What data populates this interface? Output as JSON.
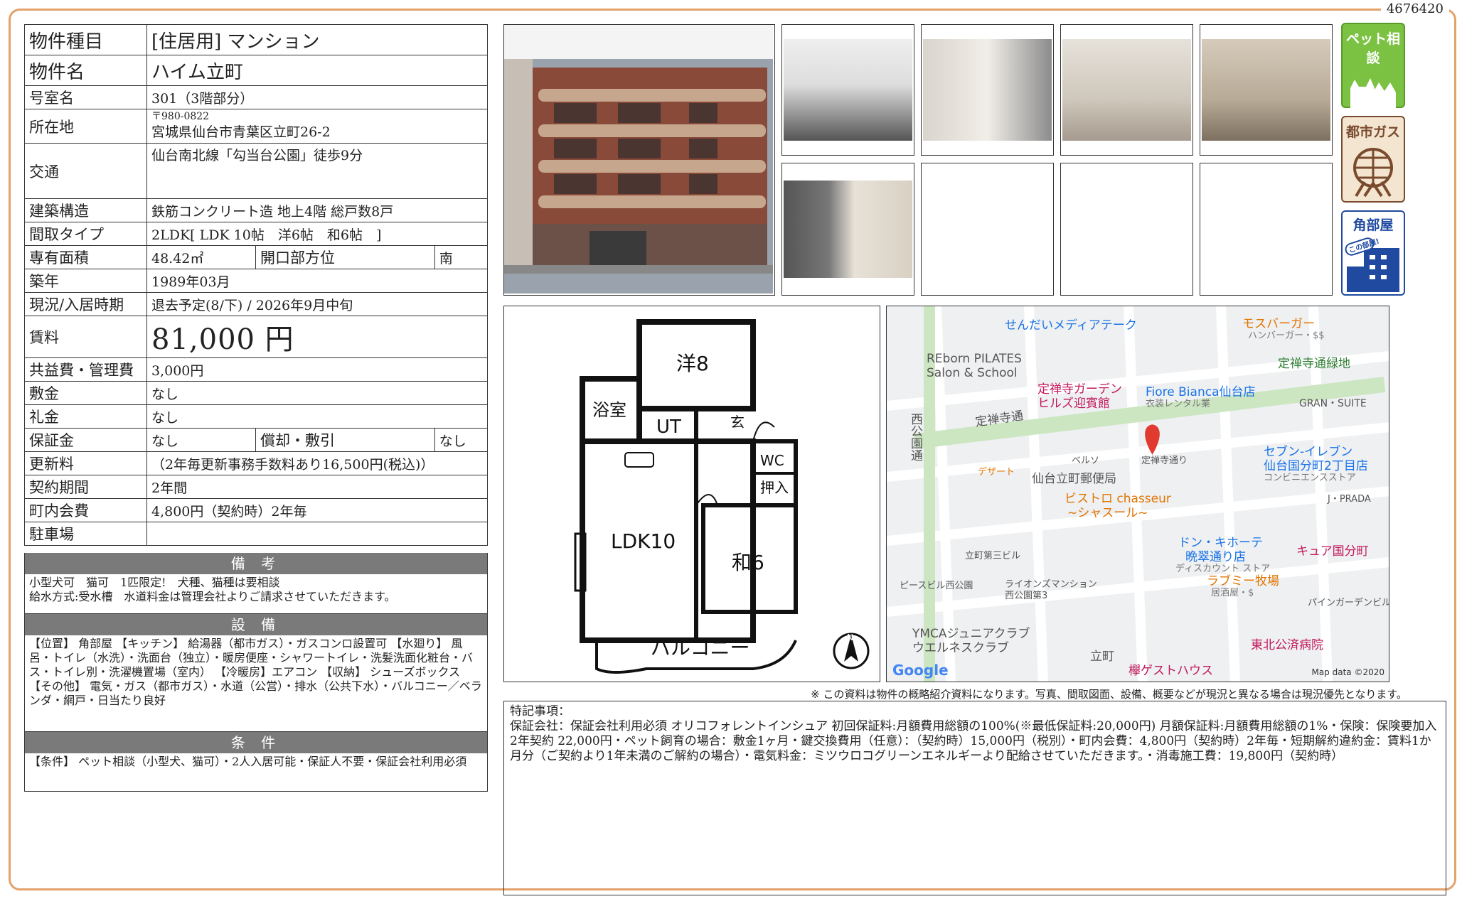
{
  "doc_id": "4676420",
  "property": {
    "type_label": "物件種目",
    "type_value": "[住居用] マンション",
    "name_label": "物件名",
    "name_value": "ハイム立町",
    "room_label": "号室名",
    "room_value": "301（3階部分）",
    "addr_label": "所在地",
    "zip": "〒980-0822",
    "addr_value": "宮城県仙台市青葉区立町26-2",
    "access_label": "交通",
    "access_value": "仙台南北線「勾当台公園」徒歩9分",
    "structure_label": "建築構造",
    "structure_value": "鉄筋コンクリート造 地上4階 総戸数8戸",
    "layout_label": "間取タイプ",
    "layout_value": "2LDK[ LDK 10帖　洋6帖　和6帖　]",
    "area_label": "専有面積",
    "area_value": "48.42㎡",
    "direction_label": "開口部方位",
    "direction_value": "南",
    "built_label": "築年",
    "built_value": "1989年03月",
    "status_label": "現況/入居時期",
    "status_value": "退去予定(8/下) / 2026年9月中旬",
    "rent_label": "賃料",
    "rent_value": "81,000 円",
    "fee_label": "共益費・管理費",
    "fee_value": "3,000円",
    "deposit_label": "敷金",
    "deposit_value": "なし",
    "keymoney_label": "礼金",
    "keymoney_value": "なし",
    "guarantee_label": "保証金",
    "guarantee_value": "なし",
    "amort_label": "償却・敷引",
    "amort_value": "なし",
    "renewal_label": "更新料",
    "renewal_value": "（2年毎更新事務手数料あり16,500円(税込)）",
    "contract_label": "契約期間",
    "contract_value": "2年間",
    "town_label": "町内会費",
    "town_value": "4,800円（契約時）2年毎",
    "parking_label": "駐車場",
    "parking_value": ""
  },
  "remarks": {
    "title": "備 考",
    "text": "小型犬可　猫可　1匹限定!　犬種、猫種は要相談\n給水方式:受水槽　水道料金は管理会社よりご請求させていただきます。"
  },
  "facilities": {
    "title": "設 備",
    "text": "【位置】 角部屋 【キッチン】 給湯器（都市ガス）・ガスコンロ設置可 【水廻り】 風呂・トイレ（水洗）・洗面台（独立）・暖房便座・シャワートイレ・洗髪洗面化粧台・バス・トイレ別・洗濯機置場（室内） 【冷暖房】エアコン 【収納】 シューズボックス 【その他】 電気・ガス（都市ガス）・水道（公営）・排水（公共下水）・バルコニー／ベランダ・網戸・日当たり良好"
  },
  "conditions": {
    "title": "条 件",
    "text": "【条件】 ペット相談（小型犬、猫可）・2人入居可能・保証人不要・保証会社利用必須"
  },
  "badges": {
    "pet": "ペット相談",
    "gas": "都市ガス",
    "corner": "角部屋",
    "corner_sub": "この部屋!"
  },
  "floorplan": {
    "rooms": {
      "western": "洋8",
      "bath": "浴室",
      "ut": "UT",
      "entrance": "玄",
      "wc": "WC",
      "closet": "押入",
      "ldk": "LDK10",
      "japanese": "和6",
      "balcony": "バルコニー"
    },
    "north": "N"
  },
  "map": {
    "labels": [
      "せんだいメディアテーク",
      "モスバーガー",
      "ハンバーガー・$$",
      "REborn PILATES",
      "Salon & School",
      "定禅寺通緑地",
      "定禅寺ガーデン",
      "ヒルズ迎賓館",
      "Fiore Bianca仙台店",
      "衣装レンタル業",
      "GRAN・SUITE",
      "定禅寺通",
      "西公園通",
      "デザート",
      "ベルソ",
      "定禅寺通り",
      "仙台立町郵便局",
      "セブン-イレブン",
      "仙台国分町2丁目店",
      "コンビニエンスストア",
      "ビストロ chasseur",
      "~シャスール~",
      "J・PRADA",
      "立町第三ビル",
      "ドン・キホーテ",
      "晩翠通り店",
      "ディスカウント ストア",
      "キュア国分町",
      "ピースビル西公園",
      "ライオンズマンション",
      "西公園第3",
      "ラブミー牧場",
      "居酒屋・$",
      "パインガーデンビル",
      "YMCAジュニアクラブ",
      "ウエルネスクラブ",
      "立町",
      "東北公済病院",
      "欅ゲストハウス"
    ],
    "google": "Google",
    "credit": "Map data ©2020"
  },
  "notice": "※ この資料は物件の概略紹介資料になります。写真、間取図面、設備、概要などが現況と異なる場合は現況優先となります。",
  "special": {
    "title": "特記事項：",
    "text": "保証会社：保証会社利用必須 オリコフォレントインシュア 初回保証料:月額費用総額の100%(※最低保証料:20,000円) 月額保証料:月額費用総額の1%・保険：保険要加入 2年契約 22,000円・ペット飼育の場合：敷金1ヶ月・鍵交換費用（任意）：（契約時）15,000円（税別）・町内会費：4,800円（契約時）2年毎・短期解約違約金：賃料1か月分（ご契約より1年未満のご解約の場合）・電気料金：ミツウロコグリーンエネルギーより配給させていただきます。・消毒施工費：19,800円（契約時）"
  },
  "colors": {
    "frame": "#e4a26a",
    "section_header": "#7a7a7a",
    "pet_green": "#7cc242",
    "gas_brown": "#7a4a2e",
    "corner_blue": "#1f4aa0"
  }
}
